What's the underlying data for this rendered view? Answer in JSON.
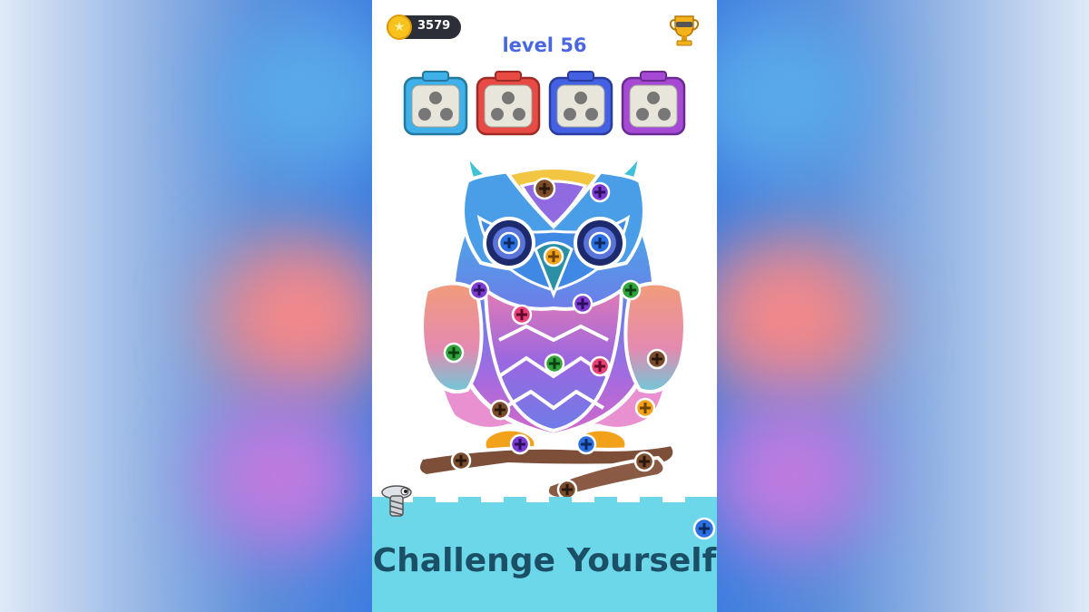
{
  "hud": {
    "coins": "3579",
    "level_label": "level 56"
  },
  "boxes": [
    {
      "color": "#3fb0e8",
      "screws": 3
    },
    {
      "color": "#e84b43",
      "screws": 3
    },
    {
      "color": "#4561e3",
      "screws": 3
    },
    {
      "color": "#a64ad6",
      "screws": 3
    }
  ],
  "icons": {
    "coin": "coin-icon",
    "trophy": "trophy-icon",
    "screw_mascot": "screw-mascot-icon",
    "add": "plus-icon"
  },
  "screw_colors": {
    "brown": "#7a4c2a",
    "purple": "#7a3bd1",
    "blue": "#2c6fe0",
    "orange": "#f2a11a",
    "green": "#2ea43b",
    "pink": "#e83f78"
  },
  "banner": {
    "text": "Challenge Yourself"
  }
}
